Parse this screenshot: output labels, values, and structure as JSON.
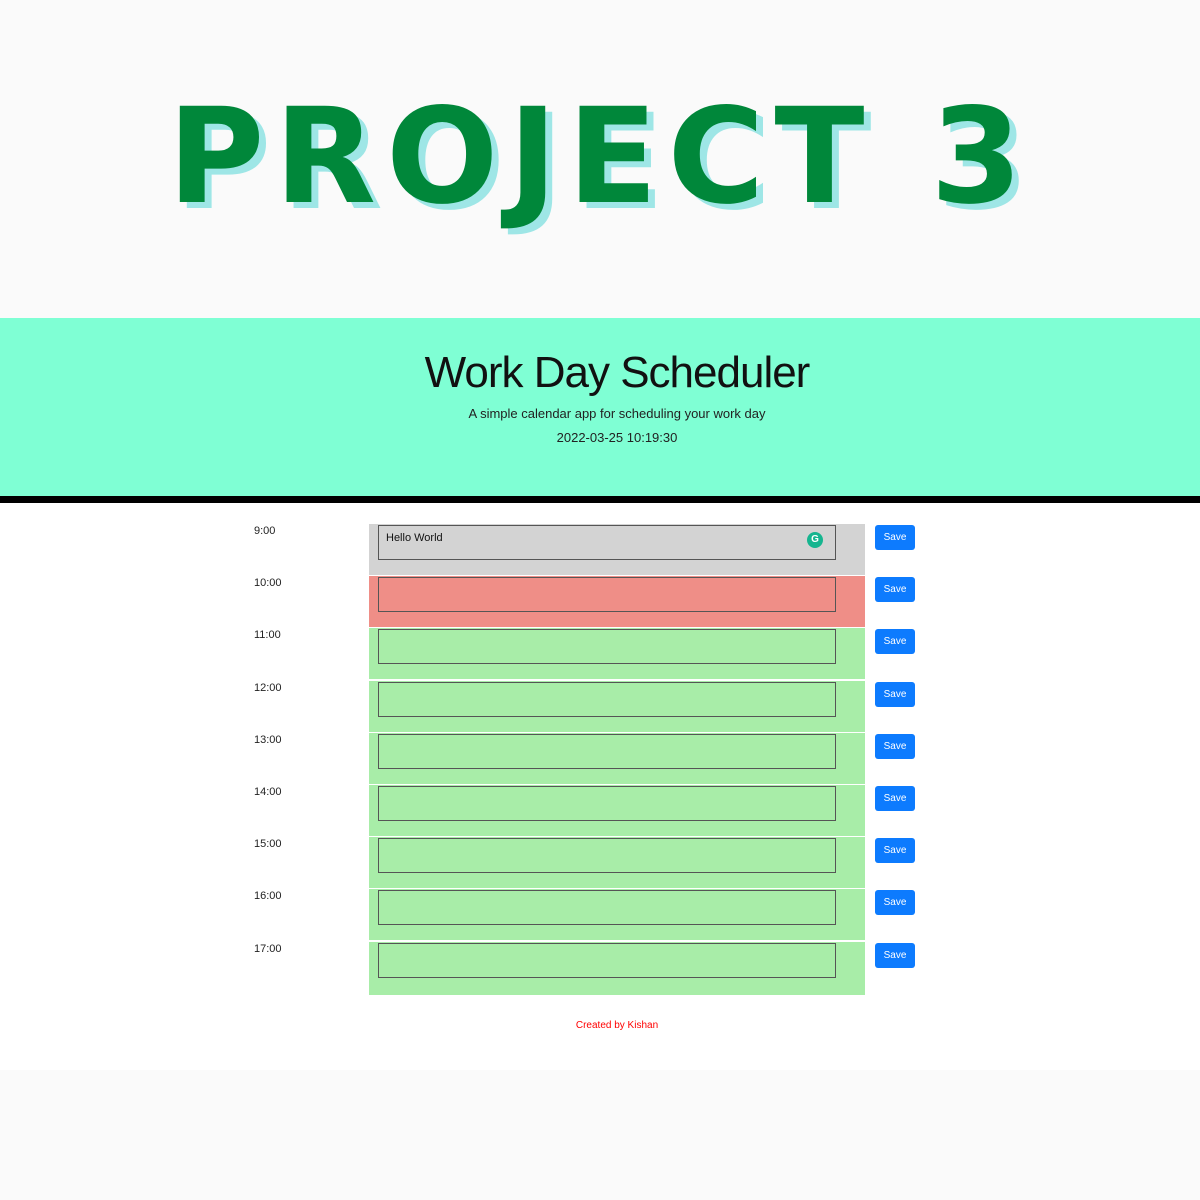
{
  "banner": {
    "title": "PROJECT 3"
  },
  "header": {
    "title": "Work Day Scheduler",
    "lead": "A simple calendar app for scheduling your work day",
    "datetime": "2022-03-25 10:19:30"
  },
  "colors": {
    "header_bg": "#7fffd4",
    "past": "#d3d3d3",
    "present": "#ef8e87",
    "future": "#a8eda8",
    "save_button": "#0d7bfe",
    "banner_text": "#00873a",
    "footer_text": "#ff0000"
  },
  "schedule": {
    "save_label": "Save",
    "rows": [
      {
        "hour": "9:00",
        "state": "past",
        "text": "Hello World"
      },
      {
        "hour": "10:00",
        "state": "present",
        "text": ""
      },
      {
        "hour": "11:00",
        "state": "future",
        "text": ""
      },
      {
        "hour": "12:00",
        "state": "future",
        "text": ""
      },
      {
        "hour": "13:00",
        "state": "future",
        "text": ""
      },
      {
        "hour": "14:00",
        "state": "future",
        "text": ""
      },
      {
        "hour": "15:00",
        "state": "future",
        "text": ""
      },
      {
        "hour": "16:00",
        "state": "future",
        "text": ""
      },
      {
        "hour": "17:00",
        "state": "future",
        "text": ""
      }
    ],
    "grammarly_glyph": "G"
  },
  "footer": {
    "credit": "Created by Kishan"
  }
}
